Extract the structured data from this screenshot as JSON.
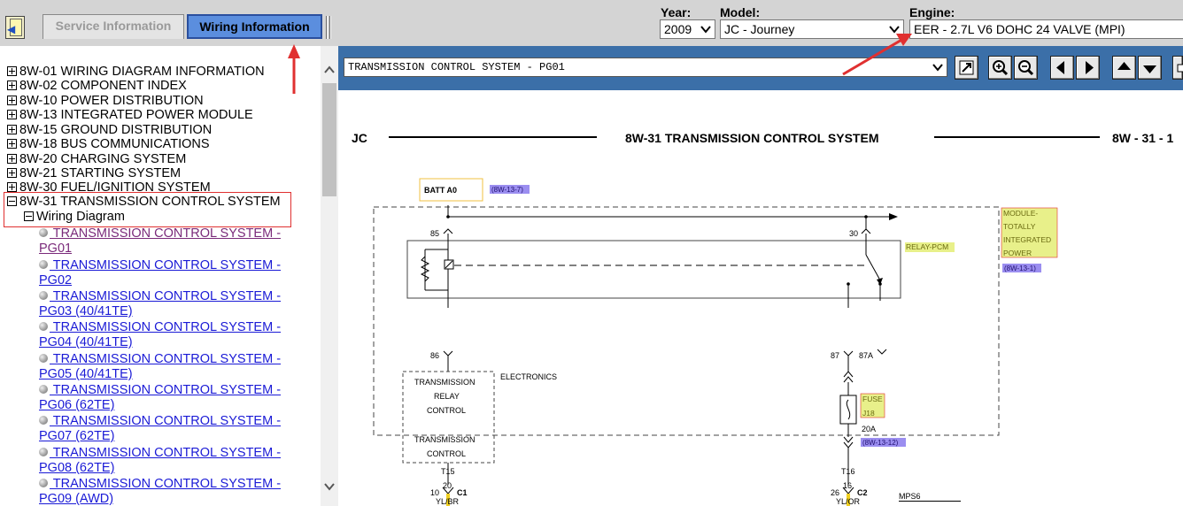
{
  "tabs": {
    "service": "Service Information",
    "wiring": "Wiring Information"
  },
  "selectors": {
    "year": {
      "label": "Year:",
      "value": "2009"
    },
    "model": {
      "label": "Model:",
      "value": "JC - Journey"
    },
    "engine": {
      "label": "Engine:",
      "value": "EER - 2.7L V6 DOHC 24 VALVE (MPI)"
    }
  },
  "tree": {
    "sections": [
      {
        "label": "8W-01 WIRING DIAGRAM INFORMATION"
      },
      {
        "label": "8W-02 COMPONENT INDEX"
      },
      {
        "label": "8W-10 POWER DISTRIBUTION"
      },
      {
        "label": "8W-13 INTEGRATED POWER MODULE"
      },
      {
        "label": "8W-15 GROUND DISTRIBUTION"
      },
      {
        "label": "8W-18 BUS COMMUNICATIONS"
      },
      {
        "label": "8W-20 CHARGING SYSTEM"
      },
      {
        "label": "8W-21 STARTING SYSTEM"
      },
      {
        "label": "8W-30 FUEL/IGNITION SYSTEM"
      },
      {
        "label": "8W-31 TRANSMISSION CONTROL SYSTEM"
      }
    ],
    "subnode": "Wiring Diagram",
    "pages": [
      {
        "line1": " TRANSMISSION CONTROL SYSTEM -",
        "line2": "PG01"
      },
      {
        "line1": " TRANSMISSION CONTROL SYSTEM -",
        "line2": "PG02"
      },
      {
        "line1": " TRANSMISSION CONTROL SYSTEM -",
        "line2": "PG03 (40/41TE)"
      },
      {
        "line1": " TRANSMISSION CONTROL SYSTEM -",
        "line2": "PG04 (40/41TE)"
      },
      {
        "line1": " TRANSMISSION CONTROL SYSTEM -",
        "line2": "PG05 (40/41TE)"
      },
      {
        "line1": " TRANSMISSION CONTROL SYSTEM -",
        "line2": "PG06 (62TE)"
      },
      {
        "line1": " TRANSMISSION CONTROL SYSTEM -",
        "line2": "PG07 (62TE)"
      },
      {
        "line1": " TRANSMISSION CONTROL SYSTEM -",
        "line2": "PG08 (62TE)"
      },
      {
        "line1": " TRANSMISSION CONTROL SYSTEM -",
        "line2": "PG09 (AWD)"
      }
    ]
  },
  "viewer": {
    "selected_diagram": "TRANSMISSION CONTROL SYSTEM - PG01",
    "toolbar_icons": [
      "fit-page-icon",
      "zoom-in-icon",
      "zoom-out-icon",
      "previous-page-icon",
      "next-page-icon",
      "page-up-icon",
      "page-down-icon",
      "print-icon"
    ]
  },
  "diagram": {
    "header_left": "JC",
    "header_title": "8W-31 TRANSMISSION CONTROL SYSTEM",
    "header_right": "8W - 31 - 1",
    "batt": "BATT A0",
    "ref_batt": "(8W-13-7)",
    "module_lines": [
      "MODULE-",
      "TOTALLY",
      "INTEGRATED",
      "POWER"
    ],
    "ref_module": "(8W-13-1)",
    "relay": "RELAY-PCM",
    "pin85": "85",
    "pin30": "30",
    "pin86": "86",
    "pin87": "87",
    "pin87a": "87A",
    "electronics": "ELECTRONICS",
    "relay_ctrl_lines": [
      "TRANSMISSION",
      "RELAY",
      "CONTROL"
    ],
    "trans_ctrl_lines": [
      "TRANSMISSION",
      "CONTROL"
    ],
    "fuse_lines": [
      "FUSE",
      "J18"
    ],
    "fuse_amps": "20A",
    "ref_fuse": "(8W-13-12)",
    "left_conn": {
      "pin": "10",
      "name": "C1",
      "circuit": "T15",
      "gauge": "20",
      "color": "YL/BR"
    },
    "right_conn": {
      "pin": "26",
      "name": "C2",
      "circuit": "T16",
      "gauge": "16",
      "color": "YL/OR"
    },
    "footer": "MPS6"
  },
  "colors": {
    "active_tab": "#5b8ede",
    "toolbar": "#3b6fa8",
    "ref_badge": "#9b8ef0",
    "label_highlight": "#e8f08a",
    "annotation_red": "#e03030"
  }
}
